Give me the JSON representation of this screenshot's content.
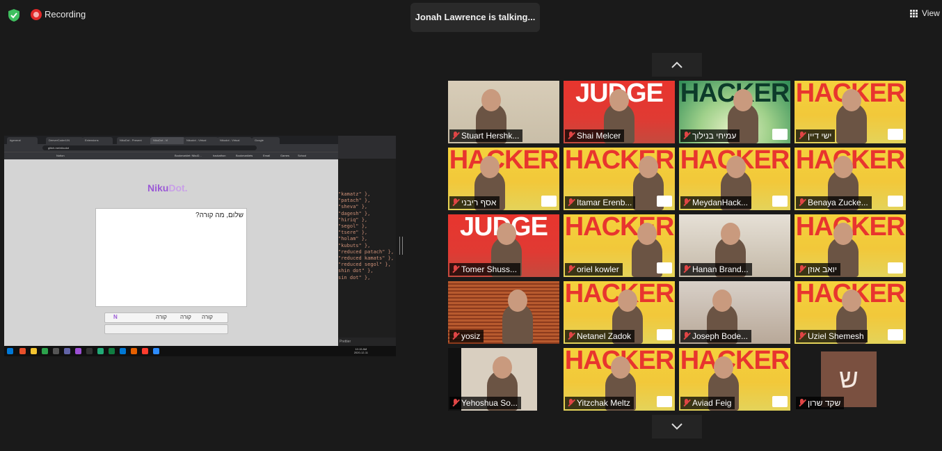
{
  "topbar": {
    "recording_label": "Recording",
    "active_speaker_banner": "Jonah Lawrence is talking...",
    "view_label": "View",
    "shield_icon": "shield-check-icon",
    "record_icon": "record-icon",
    "view_icon": "grid-view-icon"
  },
  "shared_screen": {
    "browser_tabs": [
      "#general",
      "DenverCoder1/N",
      "Extensions",
      "NikuDot - Present",
      "NikuDot - Vi",
      "Nikudot - Virtual",
      "Nikudot - Virtual",
      "Google"
    ],
    "address_bar": "glitch.me/nikudot",
    "bookmarks": [
      "Notion",
      "Bookmarklet: NikuD...",
      "hackathon",
      "Bookmarklets",
      "Email",
      "Games",
      "School"
    ],
    "app_logo_main": "Niku",
    "app_logo_accent": "Dot.",
    "editor_text": "שלום, מה קורה?",
    "nikud_toolbar_options": [
      "קורה",
      "קורה",
      "קורה"
    ],
    "nikud_toolbar_logo": "N",
    "code_lines": [
      "\"kamatz\" },",
      "\"patach\" },",
      "\"sheva\" },",
      "\"dagesh\" },",
      "\"hiriq\" },",
      "\"segol\" },",
      "\"tsere\" },",
      "\"holam\" },",
      "\"kubuts\" },",
      "\"reduced patach\" },",
      "\"reduced kamats\" },",
      "\"reduced segol\" },",
      "shin dot\" },",
      "sin dot\" },"
    ],
    "vscode_status": "Prettier",
    "taskbar_time": "10:15 AM",
    "taskbar_date": "2020-12-11"
  },
  "gallery": {
    "participants": [
      {
        "name": "Stuart Hershk...",
        "bg": "office",
        "word": "",
        "muted": true
      },
      {
        "name": "Shai Melcer",
        "bg": "judge",
        "word": "JUDGE",
        "muted": true
      },
      {
        "name": "עמיחי בנילוך",
        "bg": "hacker-green",
        "word": "HACKER",
        "muted": true
      },
      {
        "name": "ישי דיין",
        "bg": "hacker",
        "word": "HACKER",
        "muted": true
      },
      {
        "name": "אסף ריבני",
        "bg": "hacker",
        "word": "HACKER",
        "muted": true
      },
      {
        "name": "Itamar Erenb...",
        "bg": "hacker",
        "word": "HACKER",
        "muted": true
      },
      {
        "name": "MeydanHack...",
        "bg": "hacker",
        "word": "HACKER",
        "muted": true
      },
      {
        "name": "Benaya Zucke...",
        "bg": "hacker",
        "word": "HACKER",
        "muted": true
      },
      {
        "name": "Tomer Shuss...",
        "bg": "judge",
        "word": "JUDGE",
        "muted": true
      },
      {
        "name": "oriel kowler",
        "bg": "hacker",
        "word": "HACKER",
        "muted": true
      },
      {
        "name": "Hanan Brand...",
        "bg": "room",
        "word": "",
        "muted": true
      },
      {
        "name": "יואב אוזן",
        "bg": "hacker",
        "word": "HACKER",
        "muted": true
      },
      {
        "name": "yosiz",
        "bg": "blinds",
        "word": "",
        "muted": true
      },
      {
        "name": "Netanel Zadok",
        "bg": "hacker",
        "word": "HACKER",
        "muted": true
      },
      {
        "name": "Joseph Bode...",
        "bg": "closeup",
        "word": "",
        "muted": true
      },
      {
        "name": "Uziel Shemesh",
        "bg": "hacker",
        "word": "HACKER",
        "muted": true
      },
      {
        "name": "Yehoshua So...",
        "bg": "home",
        "word": "",
        "muted": true
      },
      {
        "name": "Yitzchak Meltz",
        "bg": "hacker",
        "word": "HACKER",
        "muted": true
      },
      {
        "name": "Aviad Feig",
        "bg": "hacker",
        "word": "HACKER",
        "muted": true
      },
      {
        "name": "שקד שרון",
        "bg": "avatar",
        "word": "",
        "muted": true,
        "initial": "ש"
      }
    ]
  },
  "colors": {
    "hacker_red": "#e8352e",
    "hacker_yellow": "#f4d23c",
    "hacker_green": "#2d8a55",
    "avatar_brown": "#7a5040",
    "mute_red": "#e04545",
    "logo_purple": "#9b59d6"
  }
}
